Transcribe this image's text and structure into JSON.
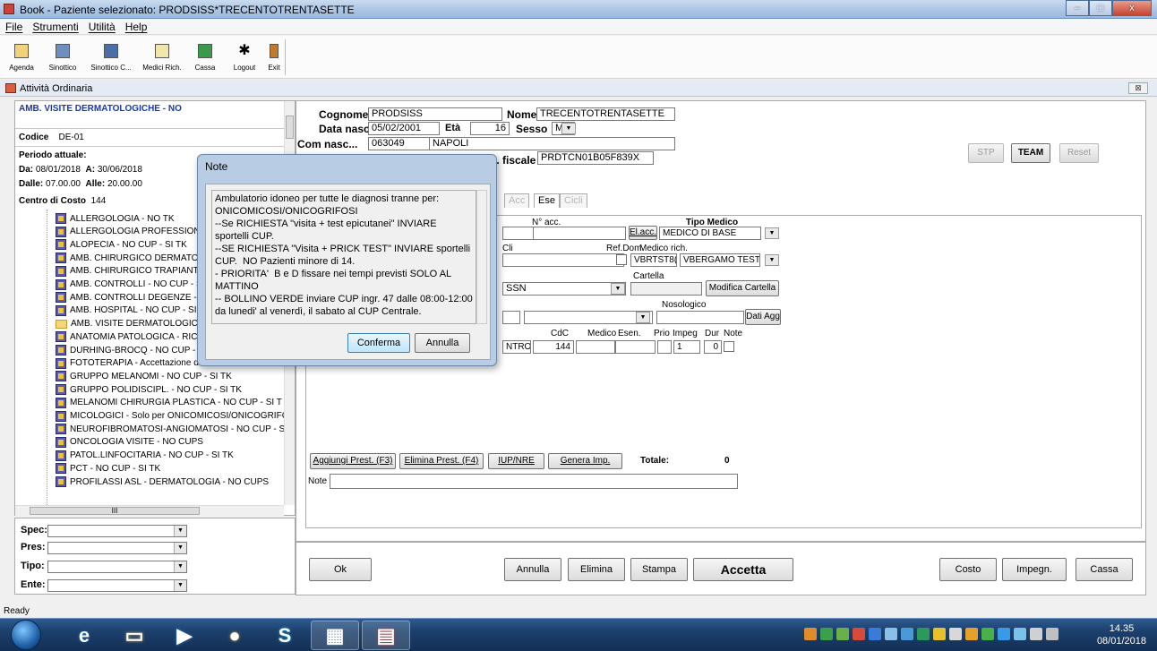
{
  "window": {
    "title": "Book - Paziente selezionato: PRODSISS*TRECENTOTRENTASETTE",
    "minimize": "–",
    "maximize": "□",
    "close": "x"
  },
  "menu": [
    "File",
    "Strumenti",
    "Utilità",
    "Help"
  ],
  "toolbar": [
    {
      "label": "Agenda",
      "icon": "agenda-icon"
    },
    {
      "label": "Sinottico",
      "icon": "sinottico-icon"
    },
    {
      "label": "Sinottico C...",
      "icon": "grid-icon"
    },
    {
      "label": "Medici Rich.",
      "icon": "document-icon"
    },
    {
      "label": "Cassa",
      "icon": "cash-register-icon"
    },
    {
      "label": "Logout",
      "icon": "running-man-icon"
    },
    {
      "label": "Exit",
      "icon": "exit-door-icon"
    }
  ],
  "inner": {
    "title": "Attività Ordinaria",
    "close": "⊠"
  },
  "left": {
    "ambulatorio": "AMB. VISITE DERMATOLOGICHE - NO",
    "codice_label": "Codice",
    "codice": "DE-01",
    "periodo_label": "Periodo attuale:",
    "da_label": "Da:",
    "da": "08/01/2018",
    "a_label": "A:",
    "a": "30/06/2018",
    "dalle_label": "Dalle:",
    "dalle": "07.00.00",
    "alle_label": "Alle:",
    "alle": "20.00.00",
    "cdc_label": "Centro di Costo",
    "cdc": "144",
    "tree": [
      "ALLERGOLOGIA - NO TK",
      "ALLERGOLOGIA PROFESSIONALE",
      "ALOPECIA - NO CUP - SI TK",
      "AMB. CHIRURGICO DERMATOL",
      "AMB. CHIRURGICO TRAPIANTA",
      "AMB. CONTROLLI - NO CUP - S",
      "AMB. CONTROLLI DEGENZE - N",
      "AMB. HOSPITAL - NO CUP - SI",
      "AMB. VISITE DERMATOLOGICH",
      "ANATOMIA PATOLOGICA - RIC",
      "DURHING-BROCQ - NO CUP - S",
      "FOTOTERAPIA - Accettazione diretta: NO CUPS",
      "GRUPPO MELANOMI - NO CUP - SI TK",
      "GRUPPO POLIDISCIPL. - NO CUP - SI TK",
      "MELANOMI CHIRURGIA PLASTICA - NO CUP - SI T",
      "MICOLOGICI - Solo per ONICOMICOSI/ONICOGRIFC",
      "NEUROFIBROMATOSI-ANGIOMATOSI - NO CUP - S",
      "ONCOLOGIA VISITE - NO CUPS",
      "PATOL.LINFOCITARIA - NO CUP - SI TK",
      "PCT - NO CUP - SI TK",
      "PROFILASSI ASL - DERMATOLOGIA - NO CUPS"
    ],
    "hscroll_grip": "III"
  },
  "filters": [
    {
      "label": "Spec:",
      "value": ""
    },
    {
      "label": "Pres:",
      "value": ""
    },
    {
      "label": "Tipo:",
      "value": ""
    },
    {
      "label": "Ente:",
      "value": ""
    }
  ],
  "patient": {
    "cognome_label": "Cognome",
    "cognome": "PRODSISS",
    "nome_label": "Nome",
    "nome": "TRECENTOTRENTASETTE",
    "nasc_label": "Data nasc",
    "nasc": "05/02/2001",
    "eta_label": "Età",
    "eta": "16",
    "sesso_label": "Sesso",
    "sesso": "M",
    "comnasc_label": "Com nasc...",
    "comnasc_code": "063049",
    "comnasc_city": "NAPOLI",
    "cf_label": "Cod. fiscale",
    "cf": "PRDTCN01B05F839X"
  },
  "buttons_top": {
    "stp": "STP",
    "team": "TEAM",
    "reset": "Reset"
  },
  "tabs": [
    "Acc",
    "Ese",
    "Cicli"
  ],
  "form": {
    "nacc_label": "N° acc.",
    "elacc": "El.acc.",
    "tipo_medico_label": "Tipo Medico",
    "tipo_medico": "MEDICO DI BASE",
    "cli_label": "Cli",
    "refdom_label": "Ref.Dom.",
    "medico_rich_label": "Medico rich.",
    "medico_code": "VBRTST8(",
    "medico_name": "VBERGAMO TEST",
    "cartella_label": "Cartella",
    "ente": "SSN",
    "modifica_cartella": "Modifica Cartella",
    "nosologico_label": "Nosologico",
    "dati_agg": "Dati Agg",
    "cols": [
      "CdC",
      "Medico",
      "Esen.",
      "Prio",
      "Impeg",
      "Dur",
      "Note"
    ],
    "row_prest": "NTROL",
    "row_cdc": "144",
    "row_impeg": "1",
    "row_dur": "0",
    "aggiungi": "Aggiungi Prest. (F3)",
    "elimina_prest": "Elimina Prest. (F4)",
    "iup": "IUP/NRE",
    "genera": "Genera Imp.",
    "totale_label": "Totale:",
    "totale": "0",
    "note_label": "Note"
  },
  "actions": {
    "ok": "Ok",
    "annulla": "Annulla",
    "elimina": "Elimina",
    "stampa": "Stampa",
    "accetta": "Accetta",
    "costo": "Costo",
    "impegn": "Impegn.",
    "cassa": "Cassa"
  },
  "status": "Ready",
  "dialog": {
    "title": "Note",
    "text": "Ambulatorio idoneo per tutte le diagnosi tranne per: ONICOMICOSI/ONICOGRIFOSI\n--Se RICHIESTA \"visita + test epicutanei\" INVIARE sportelli CUP.\n--SE RICHIESTA \"Visita + PRICK TEST\" INVIARE sportelli CUP.  NO Pazienti minore di 14.\n- PRIORITA'  B e D fissare nei tempi previsti SOLO AL MATTINO\n-- BOLLINO VERDE inviare CUP ingr. 47 dalle 08:00-12:00 da lunedi' al venerdì, il sabato al CUP Centrale.",
    "conferma": "Conferma",
    "annulla": "Annulla"
  },
  "clock": {
    "time": "14.35",
    "date": "08/01/2018"
  },
  "taskbar": [
    {
      "name": "ie-taskbar",
      "icon": "ie-icon",
      "symbol": "e"
    },
    {
      "name": "explorer-taskbar",
      "icon": "folder-icon",
      "symbol": "▭"
    },
    {
      "name": "media-taskbar",
      "icon": "media-icon",
      "symbol": "▶"
    },
    {
      "name": "chrome-taskbar",
      "icon": "chrome-icon",
      "symbol": "●"
    },
    {
      "name": "skype-taskbar",
      "icon": "skype-icon",
      "symbol": "S"
    },
    {
      "name": "app-taskbar",
      "icon": "app-icon",
      "symbol": "▦"
    },
    {
      "name": "book-taskbar",
      "icon": "book-icon",
      "symbol": "▤"
    }
  ],
  "colors": {
    "accent": "#1a3aa8",
    "taskbar": "#1c3f6b",
    "dialog": "#b8cde4"
  }
}
